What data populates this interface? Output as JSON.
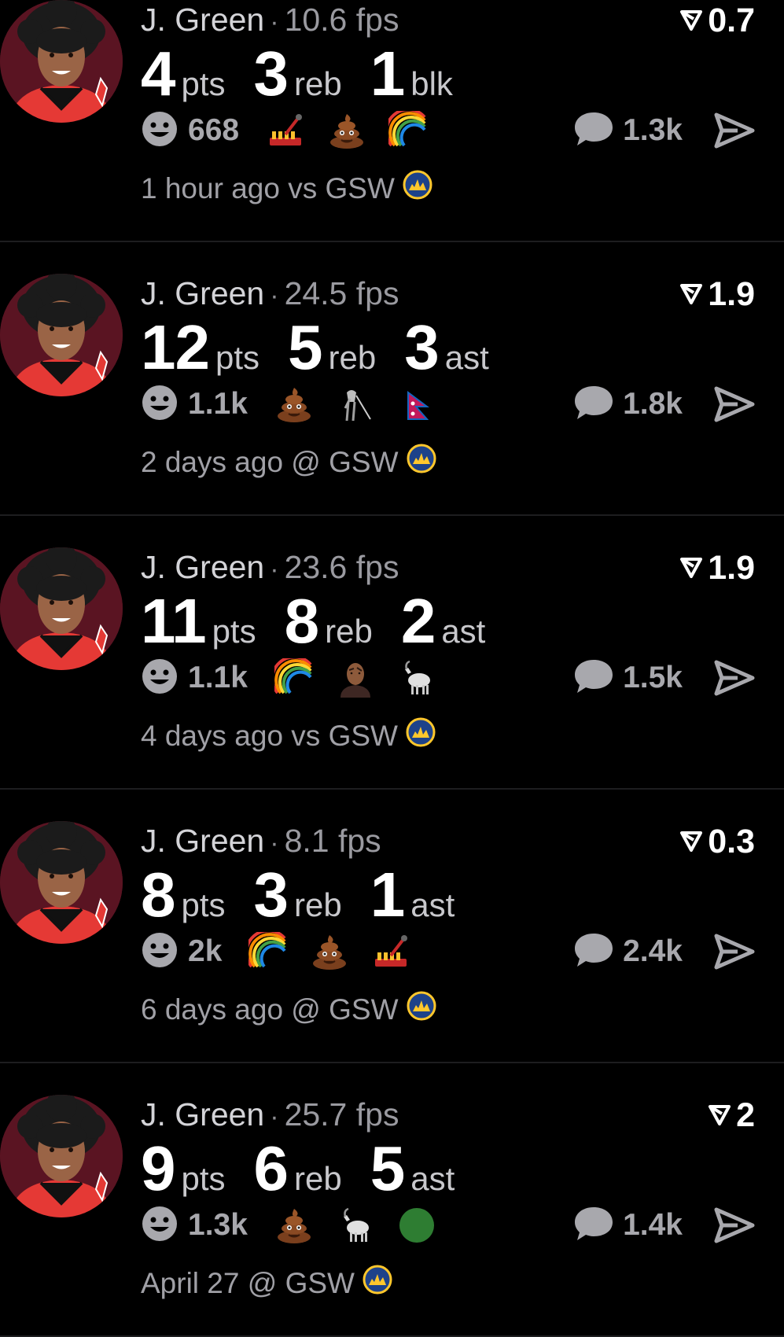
{
  "colors": {
    "background": "#000000",
    "divider": "#1d1d1f",
    "muted": "#a0a0a6",
    "team_bg": "#5a1422"
  },
  "posts": [
    {
      "player": "J. Green",
      "fps": "10.6 fps",
      "rating": "0.7",
      "stats": [
        {
          "value": "4",
          "unit": "pts"
        },
        {
          "value": "3",
          "unit": "reb"
        },
        {
          "value": "1",
          "unit": "blk"
        }
      ],
      "reactions": "668",
      "emojis": [
        "fire-alarm-icon",
        "poop-icon",
        "rainbow-icon"
      ],
      "comments": "1.3k",
      "time": "1 hour ago vs GSW",
      "opponent_logo": "warriors-logo"
    },
    {
      "player": "J. Green",
      "fps": "24.5 fps",
      "rating": "1.9",
      "stats": [
        {
          "value": "12",
          "unit": "pts"
        },
        {
          "value": "5",
          "unit": "reb"
        },
        {
          "value": "3",
          "unit": "ast"
        }
      ],
      "reactions": "1.1k",
      "emojis": [
        "poop-icon",
        "grim-reaper-icon",
        "nepal-flag-icon"
      ],
      "comments": "1.8k",
      "time": "2 days ago @ GSW",
      "opponent_logo": "warriors-logo"
    },
    {
      "player": "J. Green",
      "fps": "23.6 fps",
      "rating": "1.9",
      "stats": [
        {
          "value": "11",
          "unit": "pts"
        },
        {
          "value": "8",
          "unit": "reb"
        },
        {
          "value": "2",
          "unit": "ast"
        }
      ],
      "reactions": "1.1k",
      "emojis": [
        "rainbow-icon",
        "rock-eyebrow-icon",
        "goat-icon"
      ],
      "comments": "1.5k",
      "time": "4 days ago vs GSW",
      "opponent_logo": "warriors-logo"
    },
    {
      "player": "J. Green",
      "fps": "8.1 fps",
      "rating": "0.3",
      "stats": [
        {
          "value": "8",
          "unit": "pts"
        },
        {
          "value": "3",
          "unit": "reb"
        },
        {
          "value": "1",
          "unit": "ast"
        }
      ],
      "reactions": "2k",
      "emojis": [
        "rainbow-icon",
        "poop-icon",
        "fire-alarm-icon"
      ],
      "comments": "2.4k",
      "time": "6 days ago @ GSW",
      "opponent_logo": "warriors-logo"
    },
    {
      "player": "J. Green",
      "fps": "25.7 fps",
      "rating": "2",
      "stats": [
        {
          "value": "9",
          "unit": "pts"
        },
        {
          "value": "6",
          "unit": "reb"
        },
        {
          "value": "5",
          "unit": "ast"
        }
      ],
      "reactions": "1.3k",
      "emojis": [
        "poop-icon",
        "goat-icon",
        "green-circle-icon"
      ],
      "comments": "1.4k",
      "time": "April 27 @ GSW",
      "opponent_logo": "warriors-logo"
    }
  ]
}
